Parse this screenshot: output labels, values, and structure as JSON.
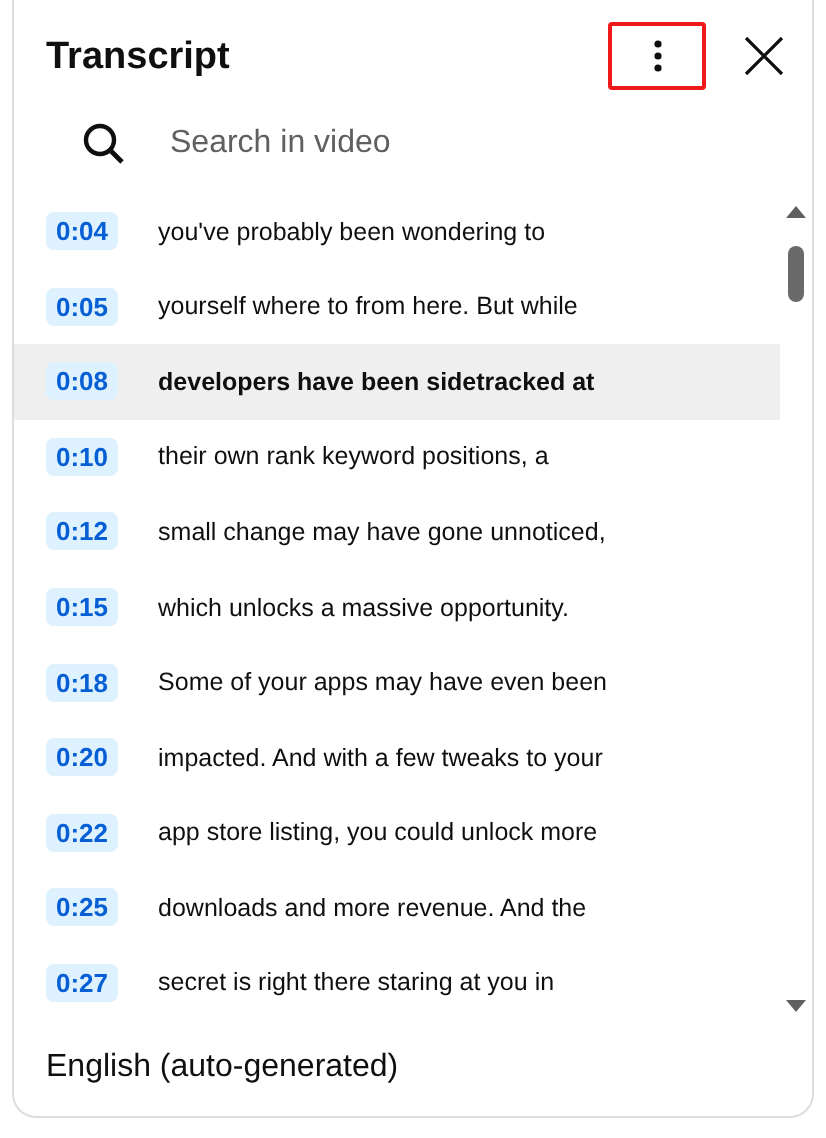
{
  "panel": {
    "title": "Transcript",
    "menu_button": {
      "highlighted": true
    }
  },
  "search": {
    "placeholder": "Search in video"
  },
  "segments": [
    {
      "time": "0:04",
      "text": "you've probably been wondering to",
      "selected": false
    },
    {
      "time": "0:05",
      "text": "yourself where to from here. But while",
      "selected": false
    },
    {
      "time": "0:08",
      "text": "developers have been sidetracked at",
      "selected": true
    },
    {
      "time": "0:10",
      "text": "their own rank keyword positions, a",
      "selected": false
    },
    {
      "time": "0:12",
      "text": "small change may have gone unnoticed,",
      "selected": false
    },
    {
      "time": "0:15",
      "text": "which unlocks a massive opportunity.",
      "selected": false
    },
    {
      "time": "0:18",
      "text": "Some of your apps may have even been",
      "selected": false
    },
    {
      "time": "0:20",
      "text": "impacted. And with a few tweaks to your",
      "selected": false
    },
    {
      "time": "0:22",
      "text": "app store listing, you could unlock more",
      "selected": false
    },
    {
      "time": "0:25",
      "text": "downloads and more revenue. And the",
      "selected": false
    },
    {
      "time": "0:27",
      "text": "secret is right there staring at you in",
      "selected": false
    }
  ],
  "footer": {
    "language": "English (auto-generated)"
  }
}
